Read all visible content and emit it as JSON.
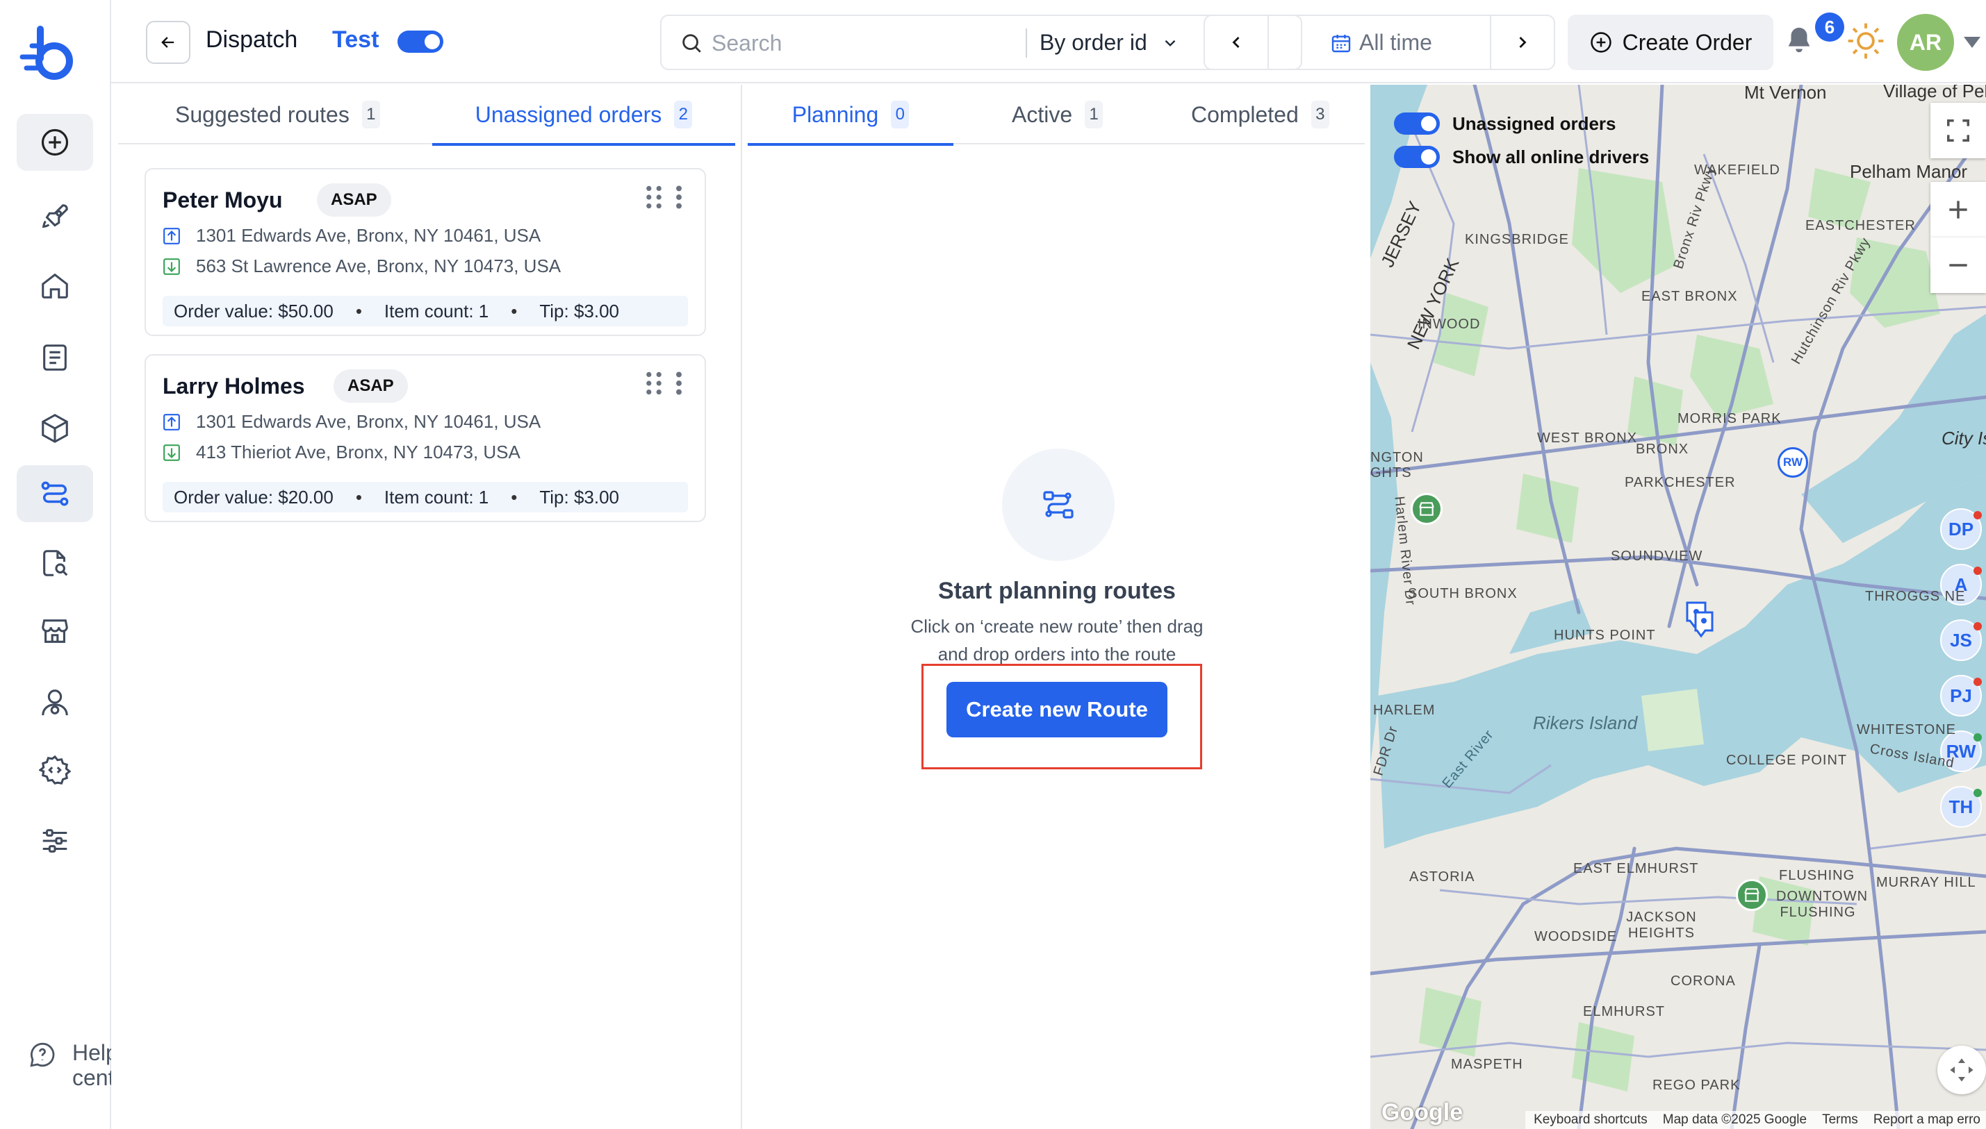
{
  "sidebar": {
    "items": [
      "new",
      "launch",
      "home",
      "orders",
      "products",
      "dispatch",
      "reports",
      "stores",
      "drivers",
      "developer",
      "settings"
    ],
    "active": "dispatch",
    "help_label": "Help center"
  },
  "header": {
    "title": "Dispatch",
    "test_label": "Test",
    "test_toggle_on": true,
    "search_placeholder": "Search",
    "search_value": "",
    "search_filter": "By order id",
    "date_range": "All time",
    "create_order_label": "Create Order",
    "notification_count": "6",
    "user_initials": "AR"
  },
  "left_panel": {
    "tabs": [
      {
        "label": "Suggested routes",
        "count": "1",
        "active": false
      },
      {
        "label": "Unassigned orders",
        "count": "2",
        "active": true
      }
    ],
    "orders": [
      {
        "customer": "Peter Moyu",
        "tag": "ASAP",
        "pickup": "1301 Edwards Ave, Bronx, NY 10461, USA",
        "dropoff": "563 St Lawrence Ave, Bronx, NY 10473, USA",
        "order_value": "Order value: $50.00",
        "item_count": "Item count: 1",
        "tip": "Tip: $3.00"
      },
      {
        "customer": "Larry Holmes",
        "tag": "ASAP",
        "pickup": "1301 Edwards Ave, Bronx, NY 10461, USA",
        "dropoff": "413 Thieriot Ave, Bronx, NY 10473, USA",
        "order_value": "Order value: $20.00",
        "item_count": "Item count: 1",
        "tip": "Tip: $3.00"
      }
    ]
  },
  "mid_panel": {
    "tabs": [
      {
        "label": "Planning",
        "count": "0",
        "active": true
      },
      {
        "label": "Active",
        "count": "1",
        "active": false
      },
      {
        "label": "Completed",
        "count": "3",
        "active": false
      }
    ],
    "empty_title": "Start planning routes",
    "empty_desc": "Click on ‘create new route’ then drag and drop orders into the route",
    "create_route_label": "Create new Route"
  },
  "map": {
    "toggles": [
      {
        "label": "Unassigned orders",
        "on": true
      },
      {
        "label": "Show all online drivers",
        "on": true
      }
    ],
    "drivers": [
      "DP",
      "A",
      "JS",
      "PJ",
      "RW",
      "TH"
    ],
    "pin_driver": "RW",
    "labels": [
      "Mt Vernon",
      "Village of Pelham",
      "Pelham Manor",
      "WAKEFIELD",
      "EASTCHESTER",
      "KINGSBRIDGE",
      "NEW YORK",
      "JERSEY",
      "EAST BRONX",
      "INWOOD",
      "MORRIS PARK",
      "WEST BRONX",
      "BRONX",
      "PARKCHESTER",
      "City Is",
      "SOUNDVIEW",
      "SOUTH BRONX",
      "THROGGS NE",
      "HUNTS POINT",
      "HARLEM",
      "Rikers Island",
      "WHITESTONE",
      "COLLEGE POINT",
      "Cross Island",
      "ASTORIA",
      "EAST ELMHURST",
      "FLUSHING",
      "DOWNTOWN FLUSHING",
      "MURRAY HILL",
      "JACKSON HEIGHTS",
      "WOODSIDE",
      "CORONA",
      "ELMHURST",
      "MASPETH",
      "REGO PARK",
      "Bronx Riv Pkwy",
      "Hutchinson Riv Pkwy",
      "Harlem River Dr",
      "East River",
      "FDR Dr",
      "NGTON",
      "GHTS"
    ],
    "google_logo": "Google",
    "attribution": [
      "Keyboard shortcuts",
      "Map data ©2025 Google",
      "Terms",
      "Report a map erro"
    ],
    "land_color": "#eceae4",
    "water_color": "#a9d3df",
    "park_color": "#c5e5bf",
    "road_color": "#8e9bc7"
  },
  "colors": {
    "accent": "#2563eb",
    "highlight": "#e53e2e",
    "avatar": "#8dc06c"
  }
}
